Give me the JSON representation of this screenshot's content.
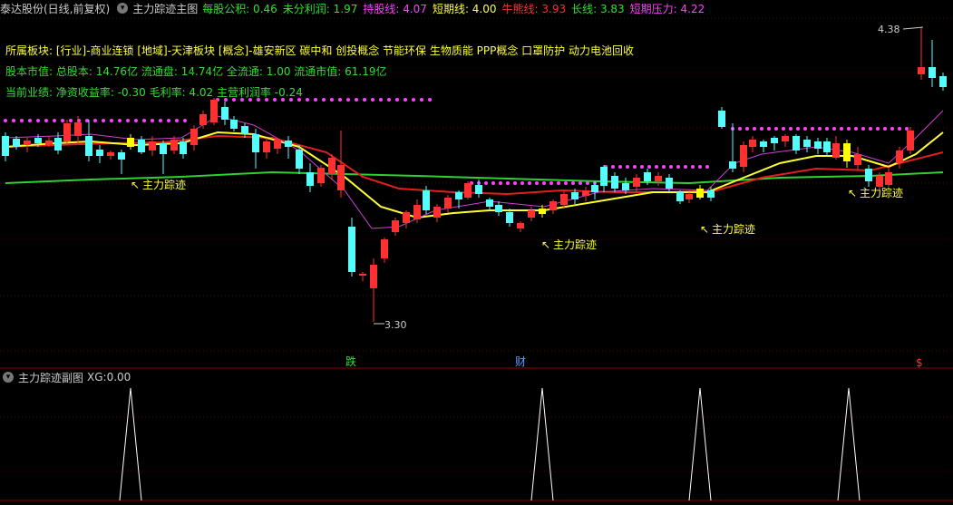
{
  "stock": {
    "name": "泰达股份(日线,前复权)",
    "indicator": "主力踪迹主图"
  },
  "header_values": [
    {
      "label": "每股公积: ",
      "value": "0.46",
      "color": "#30e030"
    },
    {
      "label": "未分利润: ",
      "value": "1.97",
      "color": "#30e030"
    },
    {
      "label": "持股线: ",
      "value": "4.07",
      "color": "#ff40ff"
    },
    {
      "label": "短期线: ",
      "value": "4.00",
      "color": "#ffff40"
    },
    {
      "label": "牛熊线: ",
      "value": "3.93",
      "color": "#ff3030"
    },
    {
      "label": "长线: ",
      "value": "3.83",
      "color": "#30e030"
    },
    {
      "label": "短期压力: ",
      "value": "4.22",
      "color": "#ff40ff"
    }
  ],
  "info": {
    "sector": "所属板块: [行业]-商业连锁 [地域]-天津板块 [概念]-雄安新区 碳中和 创投概念 节能环保 生物质能 PPP概念 口罩防护 动力电池回收",
    "capital": "股本市值: 总股本: 14.76亿 流通盘: 14.74亿 全流通: 1.00 流通市值: 61.19亿",
    "performance": "当前业绩: 净资收益率: -0.30 毛利率: 4.02 主营利润率 -0.24"
  },
  "price_labels": {
    "high": "4.38",
    "low": "3.30"
  },
  "signal_label": "主力踪迹",
  "markers": {
    "die": "跌",
    "cai": "财",
    "dollar": "$"
  },
  "sub": {
    "title": "主力踪迹副图",
    "xg_label": "XG: ",
    "xg_value": "0.00"
  },
  "colors": {
    "up": "#ff3030",
    "down": "#54fcfc",
    "yellow_candle": "#ffff00",
    "dot": "#ff40ff"
  }
}
